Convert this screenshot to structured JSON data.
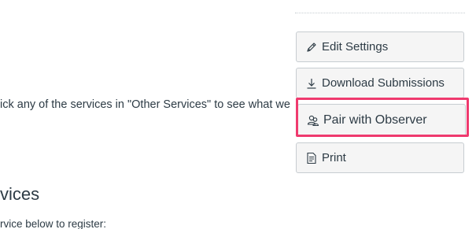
{
  "main": {
    "partial_line": "ick any of the services in \"Other Services\" to see what we",
    "heading": "vices",
    "sub_line": "rvice below to register:"
  },
  "sidebar": {
    "buttons": [
      {
        "label": "Edit Settings",
        "icon": "pencil-icon"
      },
      {
        "label": "Download Submissions",
        "icon": "download-icon"
      },
      {
        "label": "Pair with Observer",
        "icon": "observer-pair-icon"
      },
      {
        "label": "Print",
        "icon": "document-icon"
      }
    ]
  },
  "colors": {
    "highlight": "#ef3a6e",
    "button_bg": "#f5f5f5",
    "button_border": "#c7cdd1",
    "text": "#2d3b45"
  }
}
